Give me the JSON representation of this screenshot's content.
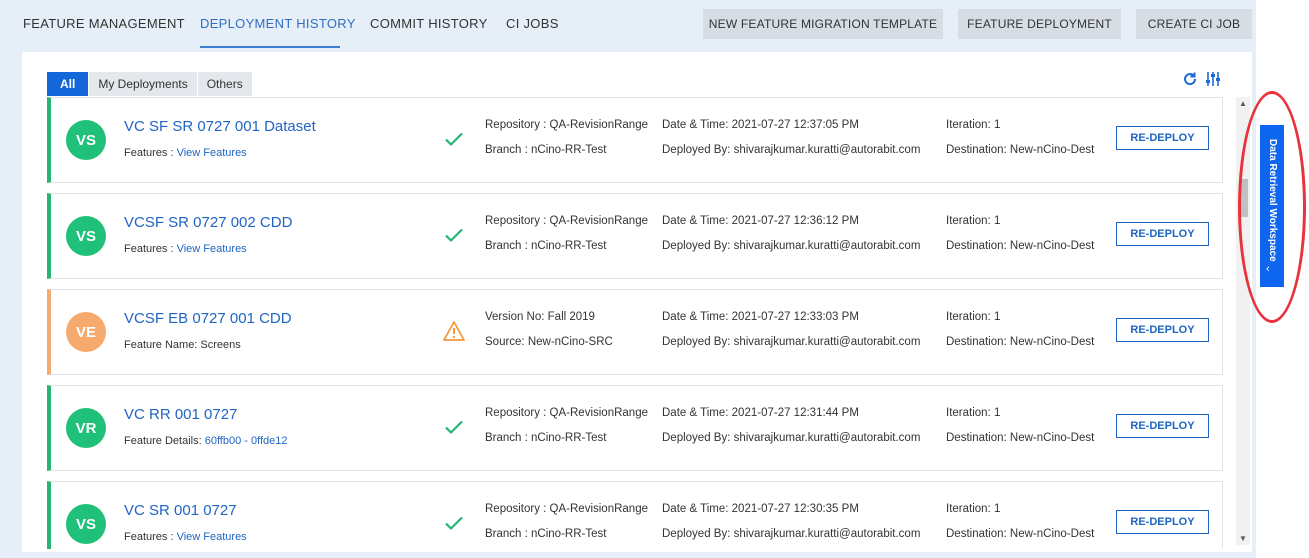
{
  "nav": {
    "tabs": [
      "FEATURE MANAGEMENT",
      "DEPLOYMENT HISTORY",
      "COMMIT HISTORY",
      "CI JOBS"
    ],
    "active_tab": "DEPLOYMENT HISTORY",
    "buttons": [
      "NEW FEATURE MIGRATION TEMPLATE",
      "FEATURE DEPLOYMENT",
      "CREATE CI JOB"
    ]
  },
  "subtabs": [
    "All",
    "My Deployments",
    "Others"
  ],
  "active_subtab": "All",
  "icons": {
    "refresh": "refresh-icon",
    "filter": "filter-sliders-icon"
  },
  "deployments": [
    {
      "initials": "VS",
      "title": "VC SF SR 0727 001 Dataset",
      "sub_label": "Features : ",
      "sub_value": "View Features",
      "sub_is_link": true,
      "status": "success",
      "info1_line1": "Repository : QA-RevisionRange",
      "info1_line2": "Branch : nCino-RR-Test",
      "datetime": "Date & Time: 2021-07-27 12:37:05 PM",
      "deployed_by": "Deployed By: shivarajkumar.kuratti@autorabit.com",
      "iteration": "Iteration: 1",
      "destination": "Destination: New-nCino-Dest",
      "action": "RE-DEPLOY"
    },
    {
      "initials": "VS",
      "title": "VCSF SR 0727 002 CDD",
      "sub_label": "Features : ",
      "sub_value": "View Features",
      "sub_is_link": true,
      "status": "success",
      "info1_line1": "Repository : QA-RevisionRange",
      "info1_line2": "Branch : nCino-RR-Test",
      "datetime": "Date & Time: 2021-07-27 12:36:12 PM",
      "deployed_by": "Deployed By: shivarajkumar.kuratti@autorabit.com",
      "iteration": "Iteration: 1",
      "destination": "Destination: New-nCino-Dest",
      "action": "RE-DEPLOY"
    },
    {
      "initials": "VE",
      "title": "VCSF EB 0727 001 CDD",
      "sub_label": "Feature Name: ",
      "sub_value": "Screens",
      "sub_is_link": false,
      "status": "warning",
      "info1_line1": "Version No: Fall 2019",
      "info1_line2": "Source: New-nCino-SRC",
      "datetime": "Date & Time: 2021-07-27 12:33:03 PM",
      "deployed_by": "Deployed By: shivarajkumar.kuratti@autorabit.com",
      "iteration": "Iteration: 1",
      "destination": "Destination: New-nCino-Dest",
      "action": "RE-DEPLOY"
    },
    {
      "initials": "VR",
      "title": "VC RR 001 0727",
      "sub_label": "Feature Details: ",
      "sub_value": "60ffb00 - 0ffde12",
      "sub_is_link": true,
      "status": "success",
      "info1_line1": "Repository : QA-RevisionRange",
      "info1_line2": "Branch : nCino-RR-Test",
      "datetime": "Date & Time: 2021-07-27 12:31:44 PM",
      "deployed_by": "Deployed By: shivarajkumar.kuratti@autorabit.com",
      "iteration": "Iteration: 1",
      "destination": "Destination: New-nCino-Dest",
      "action": "RE-DEPLOY"
    },
    {
      "initials": "VS",
      "title": "VC SR 001 0727",
      "sub_label": "Features : ",
      "sub_value": "View Features",
      "sub_is_link": true,
      "status": "success",
      "info1_line1": "Repository : QA-RevisionRange",
      "info1_line2": "Branch : nCino-RR-Test",
      "datetime": "Date & Time: 2021-07-27 12:30:35 PM",
      "deployed_by": "Deployed By: shivarajkumar.kuratti@autorabit.com",
      "iteration": "Iteration: 1",
      "destination": "Destination: New-nCino-Dest",
      "action": "RE-DEPLOY"
    }
  ],
  "side_panel": {
    "label": "Data Retrieval Workspace",
    "chevron": "‹"
  },
  "colors": {
    "accent": "#1467d8",
    "success": "#23b574",
    "warning": "#f7aa6e",
    "annotation": "#e8323c"
  }
}
